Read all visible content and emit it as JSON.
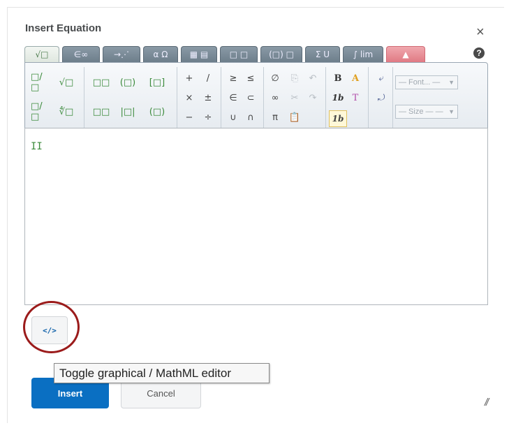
{
  "dialog": {
    "title": "Insert Equation",
    "close": "×",
    "help": "?"
  },
  "tabs": [
    {
      "label": "√□",
      "icon": "templates-icon"
    },
    {
      "label": "∈∞",
      "icon": "symbols-icon"
    },
    {
      "label": "→⋰",
      "icon": "arrows-icon"
    },
    {
      "label": "α Ω",
      "icon": "greek-icon"
    },
    {
      "label": "▦ ▤",
      "icon": "matrix-icon"
    },
    {
      "label": "□ □",
      "icon": "scripts-icon"
    },
    {
      "label": "(□) □",
      "icon": "fences-icon"
    },
    {
      "label": "Σ U",
      "icon": "sums-icon"
    },
    {
      "label": "∫ lim",
      "icon": "calculus-icon"
    },
    {
      "label": "",
      "icon": "chemistry-icon"
    }
  ],
  "toolbar": {
    "fractions": [
      "□/□",
      "√□",
      "□/□",
      "∜□"
    ],
    "scripts": [
      "□□",
      "(□)",
      "[□]",
      "□□",
      "|□|",
      "(□)"
    ],
    "operators": [
      "+",
      "/",
      "×",
      "±",
      "−",
      "÷"
    ],
    "relations": [
      "≥",
      "≤",
      "∈",
      "⊂",
      "∪",
      "∩"
    ],
    "misc": [
      "∅",
      "∞",
      "π"
    ],
    "edit": [
      "copy",
      "undo",
      "cut",
      "redo",
      "paste"
    ],
    "format": [
      "B",
      "A",
      "1b",
      "T",
      "1b"
    ],
    "font_placeholder": "— Font... —",
    "size_placeholder": "— Size — —"
  },
  "editor": {
    "content": "II"
  },
  "toggle": {
    "label": "</>",
    "tooltip": "Toggle graphical / MathML editor"
  },
  "buttons": {
    "insert": "Insert",
    "cancel": "Cancel"
  },
  "colors": {
    "primary": "#0a6fc2",
    "highlight_circle": "#9b1b1b"
  }
}
